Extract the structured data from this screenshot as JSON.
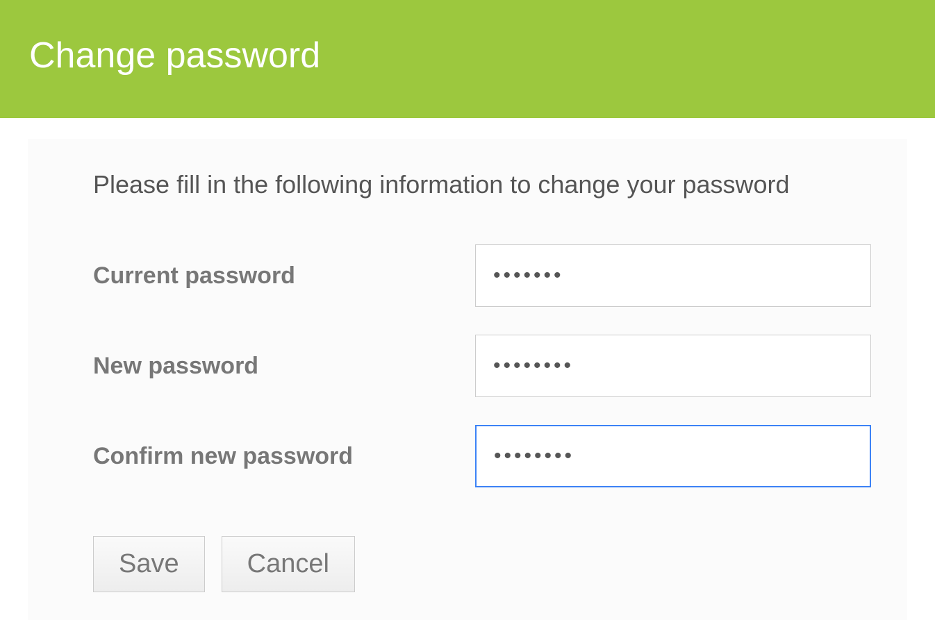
{
  "header": {
    "title": "Change password"
  },
  "form": {
    "instruction": "Please fill in the following information to change your password",
    "fields": {
      "current_password": {
        "label": "Current password",
        "value": "•••••••"
      },
      "new_password": {
        "label": "New password",
        "value": "••••••••"
      },
      "confirm_password": {
        "label": "Confirm new password",
        "value": "••••••••"
      }
    },
    "buttons": {
      "save": "Save",
      "cancel": "Cancel"
    }
  }
}
